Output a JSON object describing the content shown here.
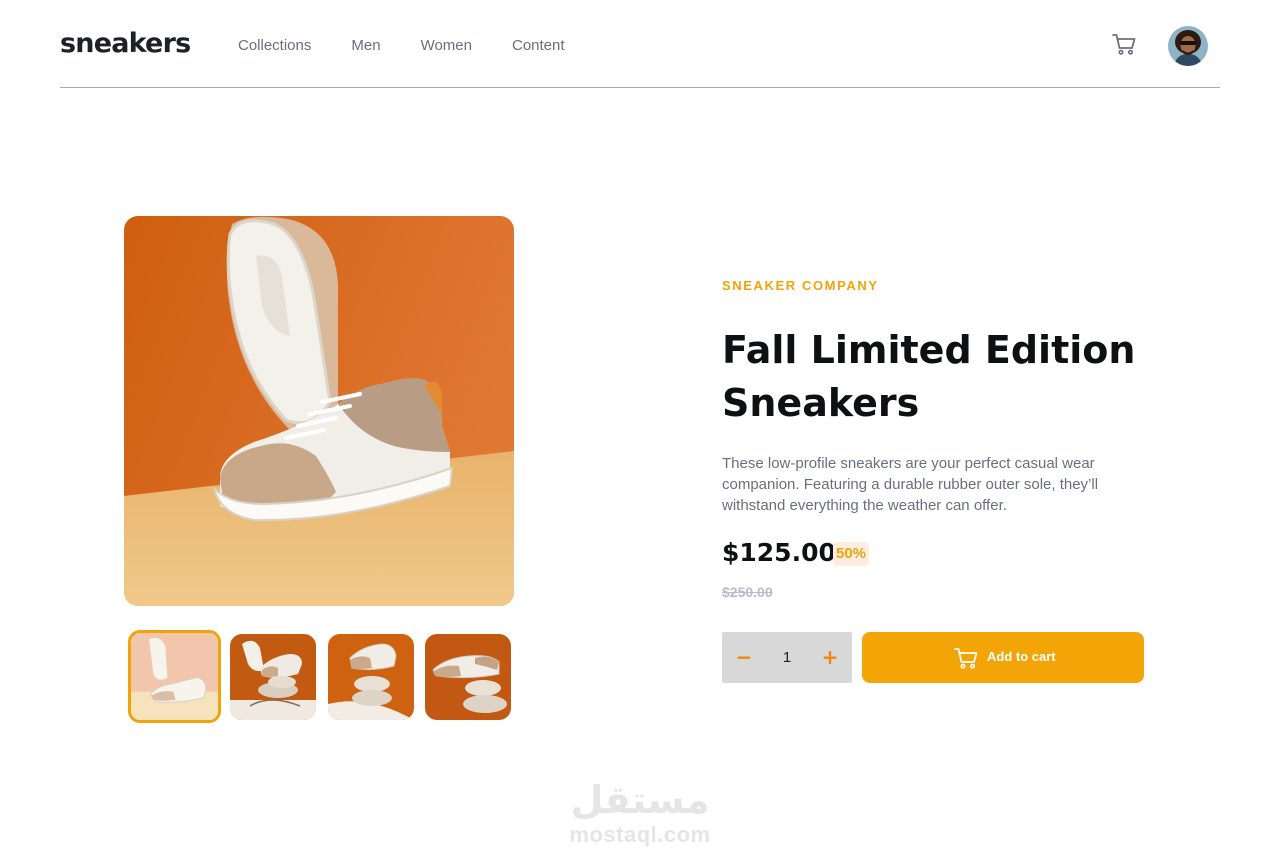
{
  "header": {
    "logo": "sneakers",
    "nav": [
      "Collections",
      "Men",
      "Women",
      "Content"
    ],
    "cart_icon": "cart-icon",
    "avatar_icon": "avatar"
  },
  "gallery": {
    "thumbnails": [
      "product-1",
      "product-2",
      "product-3",
      "product-4"
    ],
    "active_thumbnail": 0
  },
  "product": {
    "company": "SNEAKER COMPANY",
    "title": "Fall Limited Edition Sneakers",
    "description": "These low-profile sneakers are your perfect casual wear companion. Featuring a durable rubber outer sole, they’ll withstand everything the weather can offer.",
    "price": "$125.00",
    "discount": "50%",
    "old_price": "$250.00"
  },
  "cart_controls": {
    "minus_label": "−",
    "quantity": "1",
    "plus_label": "+",
    "add_label": "Add to cart"
  },
  "watermark": {
    "arabic": "مستقل",
    "latin": "mostaql.com"
  },
  "colors": {
    "accent": "#f0a30a",
    "button": "#f3a507",
    "text_dark": "#0f1014",
    "text_muted": "#69707d"
  }
}
